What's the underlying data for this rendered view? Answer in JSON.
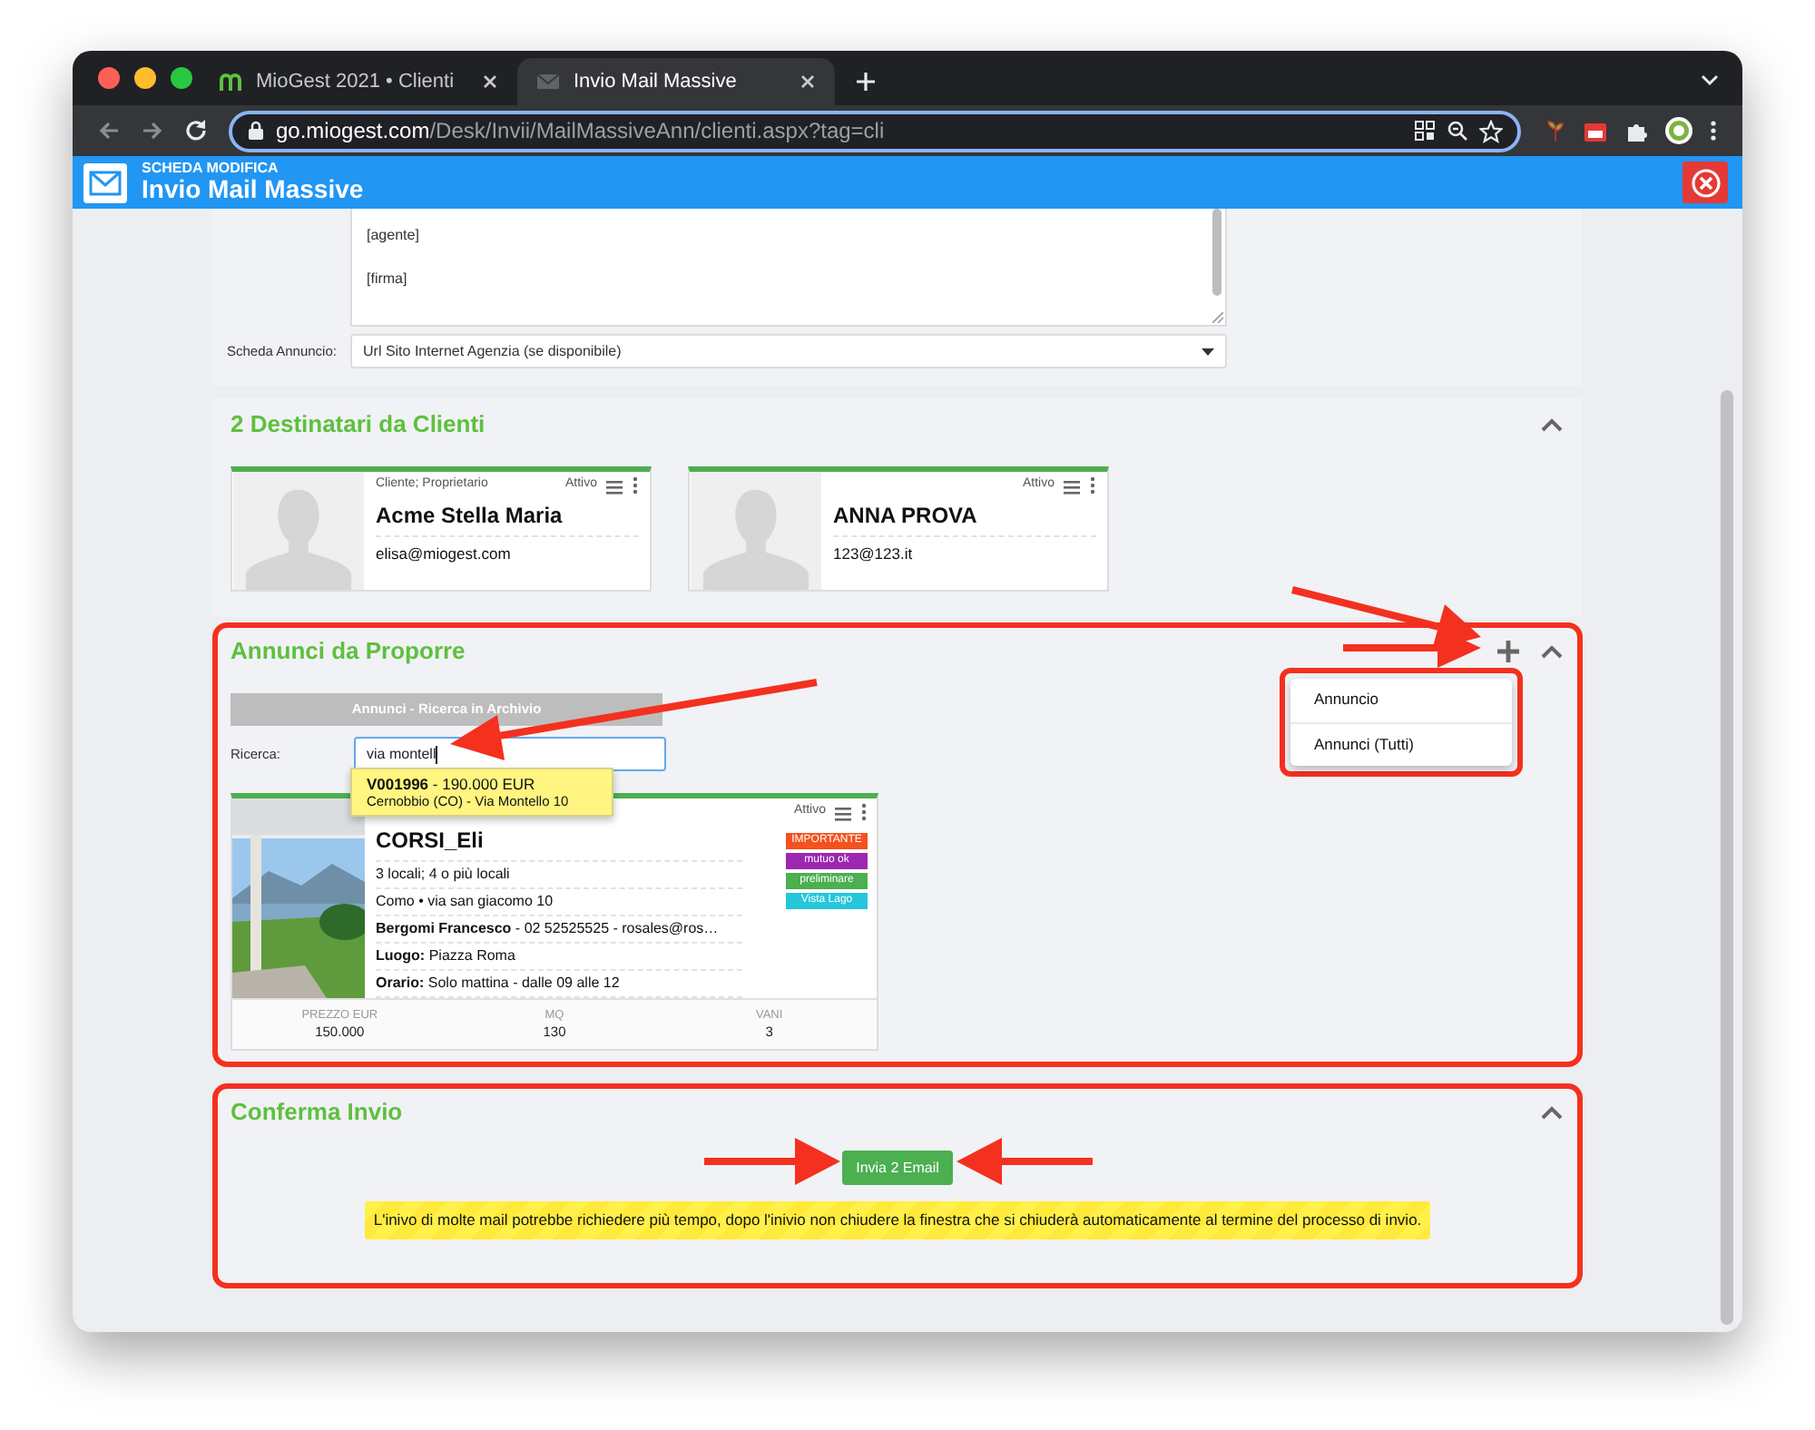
{
  "browser": {
    "tabs": [
      {
        "label": "MioGest 2021 • Clienti",
        "selected": false
      },
      {
        "label": "Invio Mail Massive",
        "selected": true
      }
    ],
    "url": {
      "host": "go.miogest.com",
      "path": "/Desk/Invii/MailMassiveAnn/clienti.aspx?tag=cli"
    }
  },
  "header": {
    "subtitle": "SCHEDA MODIFICA",
    "title": "Invio Mail Massive"
  },
  "message": {
    "lines": [
      "[agente]",
      "[firma]"
    ]
  },
  "scheda_annuncio": {
    "label": "Scheda Annuncio:",
    "value": "Url Sito Internet Agenzia (se disponibile)"
  },
  "destinatari": {
    "title": "2 Destinatari da Clienti",
    "expanded": true,
    "highlighted": false,
    "contacts": [
      {
        "category": "Cliente; Proprietario",
        "status": "Attivo",
        "name": "Acme Stella Maria",
        "email": "elisa@miogest.com"
      },
      {
        "status": "Attivo",
        "name": "ANNA PROVA",
        "email": "123@123.it"
      }
    ]
  },
  "annunci": {
    "title": "Annunci da Proporre",
    "expanded": true,
    "highlighted": true,
    "search_header": "Annunci - Ricerca in Archivio",
    "search_label": "Ricerca:",
    "search_value": "via montell",
    "suggestions": [
      {
        "title": "**V001996** - 190.000 EUR",
        "subtitle": "Cernobbio (CO) - Via Montello 10"
      }
    ],
    "add_menu": {
      "highlighted": true,
      "items": [
        "Annuncio",
        "Annunci (Tutti)"
      ]
    },
    "listing": {
      "status": "Attivo",
      "title": "CORSI_Eli",
      "kind": "picture",
      "lines": [
        "3 locali; 4 o più locali",
        "Como • via san giacomo 10",
        "**Bergomi Francesco** - 02 52525525 - rosales@ros…",
        "**Luogo:** Piazza Roma",
        "**Orario:** Solo mattina - dalle 09 alle 12"
      ],
      "tags": [
        {
          "label": "IMPORTANTE",
          "color": "#f4511e"
        },
        {
          "label": "mutuo ok",
          "color": "#9c27b0"
        },
        {
          "label": "preliminare",
          "color": "#4caf50"
        },
        {
          "label": "Vista Lago",
          "color": "#26c6da"
        }
      ],
      "stats": [
        {
          "label": "PREZZO EUR",
          "value": "150.000"
        },
        {
          "label": "MQ",
          "value": "130"
        },
        {
          "label": "VANI",
          "value": "3"
        }
      ]
    }
  },
  "conferma": {
    "title": "Conferma Invio",
    "expanded": true,
    "highlighted": true,
    "button": "Invia 2 Email",
    "note": "L'inivo di molte mail potrebbe richiedere più tempo, dopo l'inivio non chiudere la finestra che si chiuderà automaticamente al termine del processo di invio."
  }
}
